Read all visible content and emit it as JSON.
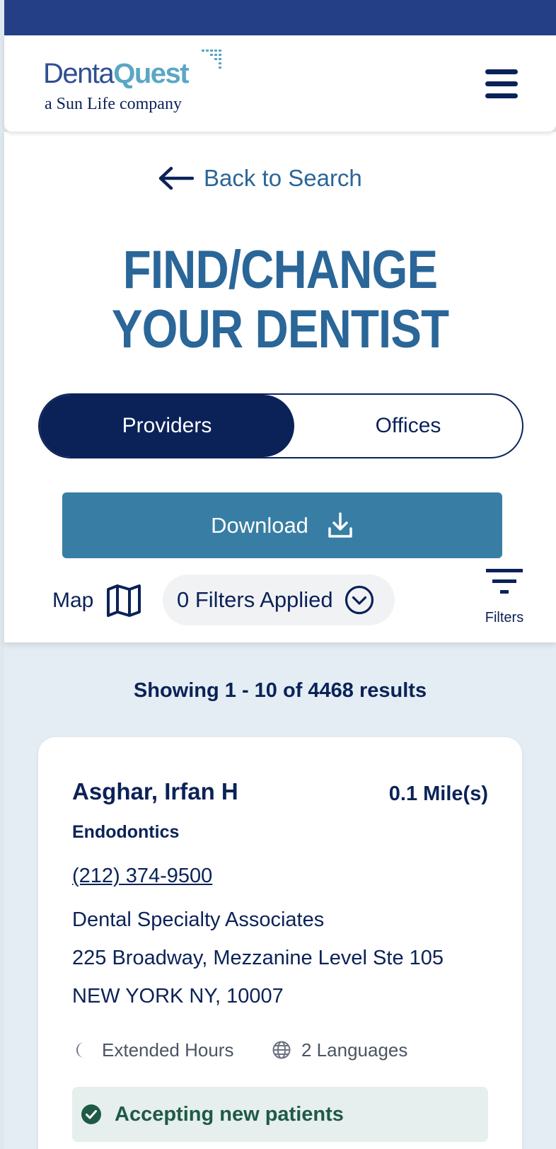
{
  "header": {
    "logo_part1": "Denta",
    "logo_part2": "Quest",
    "logo_tagline": "a Sun Life company",
    "menu_icon": "hamburger-menu-icon"
  },
  "nav": {
    "back_label": "Back to Search",
    "back_icon": "arrow-left-icon"
  },
  "page": {
    "title_line1": "FIND/CHANGE",
    "title_line2": "YOUR DENTIST"
  },
  "toggle": {
    "providers_label": "Providers",
    "offices_label": "Offices",
    "selected": "Providers"
  },
  "actions": {
    "download_label": "Download",
    "download_icon": "download-icon",
    "map_label": "Map",
    "map_icon": "map-icon",
    "filters_applied_label": "0 Filters Applied",
    "filters_applied_icon": "chevron-down-circle-icon",
    "filters_label": "Filters",
    "filters_icon": "filter-lines-icon"
  },
  "results": {
    "summary": "Showing 1 - 10 of 4468 results",
    "items": [
      {
        "name": "Asghar, Irfan H",
        "distance": "0.1 Mile(s)",
        "specialty": "Endodontics",
        "phone": "(212) 374-9500",
        "practice": "Dental Specialty Associates",
        "street": "225 Broadway, Mezzanine Level Ste 105",
        "city_state_zip": "NEW YORK NY, 10007",
        "hours_label": "Extended Hours",
        "hours_icon": "moon-icon",
        "languages_label": "2 Languages",
        "languages_icon": "globe-icon",
        "status_label": "Accepting new patients",
        "status_icon": "check-circle-icon"
      }
    ]
  },
  "colors": {
    "navy": "#0b2258",
    "top_bar": "#243f86",
    "title_blue": "#2a6698",
    "download_blue": "#387ea4",
    "logo_teal": "#5aa7c4",
    "page_bg": "#e3edf3",
    "accepting_bg": "#e6eeee",
    "accepting_text": "#1f5a45"
  }
}
